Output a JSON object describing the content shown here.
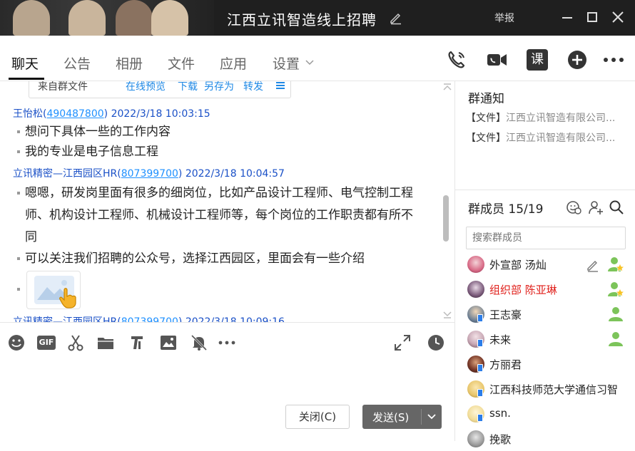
{
  "window": {
    "title": "江西立讯智造线上招聘",
    "report_label": "举报",
    "controls": [
      "minimize-icon",
      "maximize-icon",
      "close-icon"
    ]
  },
  "tabs": [
    {
      "label": "聊天",
      "active": true
    },
    {
      "label": "公告"
    },
    {
      "label": "相册"
    },
    {
      "label": "文件"
    },
    {
      "label": "应用"
    },
    {
      "label": "设置"
    }
  ],
  "toolbar_icons": [
    "phone-call-icon",
    "video-call-icon",
    "course-icon",
    "add-circle-icon",
    "more-icon"
  ],
  "toolbar": {
    "course_label": "课"
  },
  "file_card": {
    "name": "来自群文件",
    "actions": [
      "在线预览",
      "下载",
      "另存为",
      "转发"
    ]
  },
  "messages": [
    {
      "sender": "王怡松",
      "uid": "490487800",
      "time": "2022/3/18 10:03:15",
      "lines": [
        "想问下具体一些的工作内容",
        "我的专业是电子信息工程"
      ]
    },
    {
      "sender": "立讯精密—江西园区HR",
      "uid": "807399700",
      "time": "2022/3/18 10:04:57",
      "lines": [
        "嗯嗯，研发岗里面有很多的细岗位，比如产品设计工程师、电气控制工程",
        "师、机构设计工程师、机械设计工程师等，每个岗位的工作职责都有所不",
        "同",
        "可以关注我们招聘的公众号，选择江西园区，里面会有一些介绍"
      ]
    },
    {
      "sender": "立讯精密—江西园区HR",
      "uid": "807399700",
      "time": "2022/3/18 10:09:16"
    }
  ],
  "input_toolbar_icons": [
    "emoji-icon",
    "gif-icon",
    "scissors-icon",
    "folder-icon",
    "music-icon",
    "image-icon",
    "mute-bell-icon",
    "more-dots-icon",
    "expand-icon",
    "history-clock-icon"
  ],
  "input_toolbar": {
    "gif_label": "GIF"
  },
  "buttons": {
    "close": "关闭(C)",
    "send": "发送(S)"
  },
  "notice": {
    "title": "群通知",
    "items": [
      {
        "tag": "【文件】",
        "text": "江西立讯智造有限公司..."
      },
      {
        "tag": "【文件】",
        "text": "江西立讯智造有限公司..."
      }
    ]
  },
  "members": {
    "title": "群成员 15/19",
    "search_placeholder": "搜索群成员",
    "list": [
      {
        "name": "外宣部 汤灿",
        "role": "admin-star",
        "editable": true
      },
      {
        "name": "组织部 陈亚琳",
        "role": "admin-star",
        "color": "#e0201b"
      },
      {
        "name": "王志豪",
        "role": "member",
        "mobile": true
      },
      {
        "name": "未来",
        "role": "member",
        "mobile": true
      },
      {
        "name": "方丽君",
        "mobile": true
      },
      {
        "name": "江西科技师范大学通信习智",
        "mobile": true
      },
      {
        "name": "ssn.",
        "mobile": true
      },
      {
        "name": "挽歌"
      }
    ]
  },
  "colors": {
    "titlebar": "#1f1f1f",
    "accent": "#1e88e5",
    "sender": "#1a50c7",
    "highlight_name": "#e0201b",
    "send_button": "#666666"
  }
}
